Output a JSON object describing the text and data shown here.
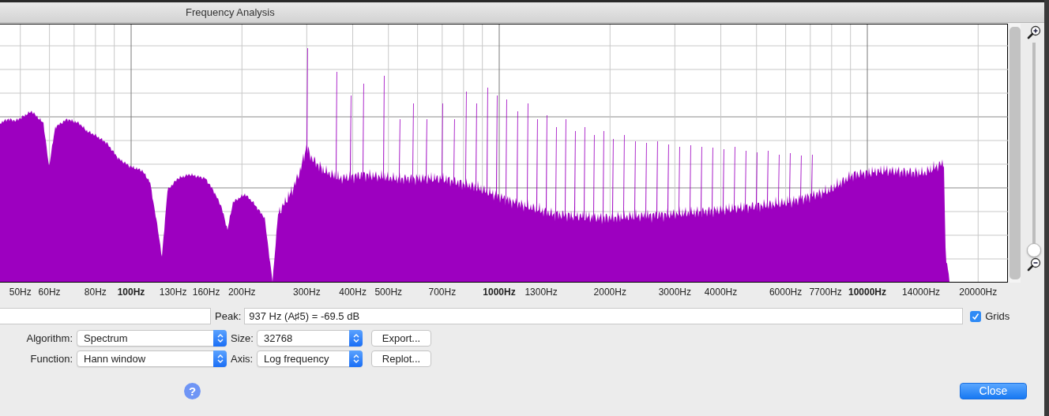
{
  "window": {
    "title": "Frequency Analysis"
  },
  "plot": {
    "x_axis_labels": [
      {
        "label": "50Hz",
        "major": false
      },
      {
        "label": "60Hz",
        "major": false
      },
      {
        "label": "80Hz",
        "major": false
      },
      {
        "label": "100Hz",
        "major": true
      },
      {
        "label": "130Hz",
        "major": false
      },
      {
        "label": "160Hz",
        "major": false
      },
      {
        "label": "200Hz",
        "major": false
      },
      {
        "label": "300Hz",
        "major": false
      },
      {
        "label": "400Hz",
        "major": false
      },
      {
        "label": "500Hz",
        "major": false
      },
      {
        "label": "700Hz",
        "major": false
      },
      {
        "label": "1000Hz",
        "major": true
      },
      {
        "label": "1300Hz",
        "major": false
      },
      {
        "label": "2000Hz",
        "major": false
      },
      {
        "label": "3000Hz",
        "major": false
      },
      {
        "label": "4000Hz",
        "major": false
      },
      {
        "label": "6000Hz",
        "major": false
      },
      {
        "label": "7700Hz",
        "major": false
      },
      {
        "label": "10000Hz",
        "major": true
      },
      {
        "label": "14000Hz",
        "major": false
      },
      {
        "label": "20000Hz",
        "major": false
      }
    ]
  },
  "zoom_slider": {
    "level": 0
  },
  "peak": {
    "label": "Peak:",
    "value": "937 Hz (A♯5) = -69.5 dB"
  },
  "grids": {
    "label": "Grids",
    "checked": true
  },
  "controls": [
    {
      "label": "Algorithm:",
      "value": "Spectrum"
    },
    {
      "label": "Size:",
      "value": "32768"
    },
    {
      "label": "Function:",
      "value": "Hann window"
    },
    {
      "label": "Axis:",
      "value": "Log frequency"
    }
  ],
  "buttons": [
    {
      "label": "Export..."
    },
    {
      "label": "Replot..."
    }
  ],
  "help": {
    "label": "?"
  },
  "close_button": {
    "label": "Close",
    "default": true
  }
}
